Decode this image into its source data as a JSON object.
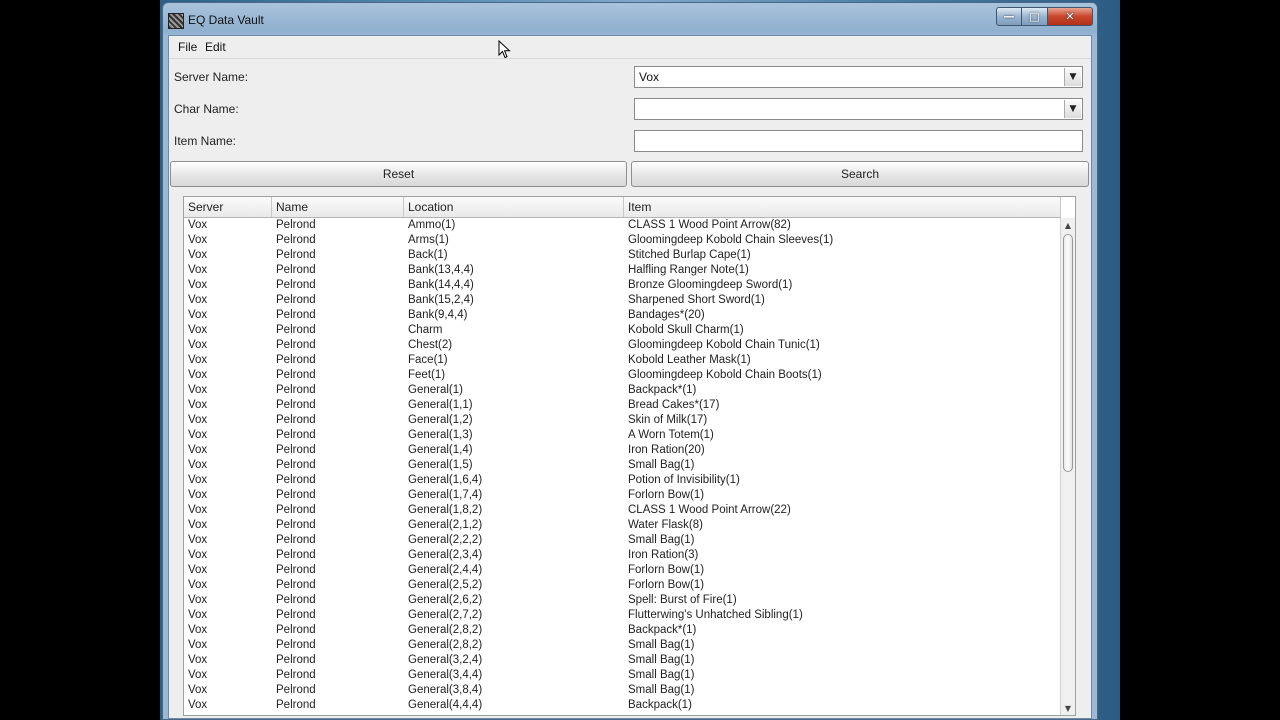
{
  "window": {
    "title": "EQ Data Vault"
  },
  "menu": {
    "file": "File",
    "edit": "Edit"
  },
  "form": {
    "server_label": "Server Name:",
    "server_value": "Vox",
    "char_label": "Char Name:",
    "char_value": "",
    "item_label": "Item Name:",
    "item_value": ""
  },
  "buttons": {
    "reset": "Reset",
    "search": "Search"
  },
  "table": {
    "columns": [
      "Server",
      "Name",
      "Location",
      "Item"
    ],
    "rows": [
      [
        "Vox",
        "Pelrond",
        "Ammo(1)",
        "CLASS 1 Wood Point Arrow(82)"
      ],
      [
        "Vox",
        "Pelrond",
        "Arms(1)",
        "Gloomingdeep Kobold Chain Sleeves(1)"
      ],
      [
        "Vox",
        "Pelrond",
        "Back(1)",
        "Stitched Burlap Cape(1)"
      ],
      [
        "Vox",
        "Pelrond",
        "Bank(13,4,4)",
        "Halfling Ranger Note(1)"
      ],
      [
        "Vox",
        "Pelrond",
        "Bank(14,4,4)",
        "Bronze Gloomingdeep Sword(1)"
      ],
      [
        "Vox",
        "Pelrond",
        "Bank(15,2,4)",
        "Sharpened Short Sword(1)"
      ],
      [
        "Vox",
        "Pelrond",
        "Bank(9,4,4)",
        "Bandages*(20)"
      ],
      [
        "Vox",
        "Pelrond",
        "Charm",
        "Kobold Skull Charm(1)"
      ],
      [
        "Vox",
        "Pelrond",
        "Chest(2)",
        "Gloomingdeep Kobold Chain Tunic(1)"
      ],
      [
        "Vox",
        "Pelrond",
        "Face(1)",
        "Kobold Leather Mask(1)"
      ],
      [
        "Vox",
        "Pelrond",
        "Feet(1)",
        "Gloomingdeep Kobold Chain Boots(1)"
      ],
      [
        "Vox",
        "Pelrond",
        "General(1)",
        "Backpack*(1)"
      ],
      [
        "Vox",
        "Pelrond",
        "General(1,1)",
        "Bread Cakes*(17)"
      ],
      [
        "Vox",
        "Pelrond",
        "General(1,2)",
        "Skin of Milk(17)"
      ],
      [
        "Vox",
        "Pelrond",
        "General(1,3)",
        "A Worn Totem(1)"
      ],
      [
        "Vox",
        "Pelrond",
        "General(1,4)",
        "Iron Ration(20)"
      ],
      [
        "Vox",
        "Pelrond",
        "General(1,5)",
        "Small Bag(1)"
      ],
      [
        "Vox",
        "Pelrond",
        "General(1,6,4)",
        "Potion of Invisibility(1)"
      ],
      [
        "Vox",
        "Pelrond",
        "General(1,7,4)",
        "Forlorn Bow(1)"
      ],
      [
        "Vox",
        "Pelrond",
        "General(1,8,2)",
        "CLASS 1 Wood Point Arrow(22)"
      ],
      [
        "Vox",
        "Pelrond",
        "General(2,1,2)",
        "Water Flask(8)"
      ],
      [
        "Vox",
        "Pelrond",
        "General(2,2,2)",
        "Small Bag(1)"
      ],
      [
        "Vox",
        "Pelrond",
        "General(2,3,4)",
        "Iron Ration(3)"
      ],
      [
        "Vox",
        "Pelrond",
        "General(2,4,4)",
        "Forlorn Bow(1)"
      ],
      [
        "Vox",
        "Pelrond",
        "General(2,5,2)",
        "Forlorn Bow(1)"
      ],
      [
        "Vox",
        "Pelrond",
        "General(2,6,2)",
        "Spell: Burst of Fire(1)"
      ],
      [
        "Vox",
        "Pelrond",
        "General(2,7,2)",
        "Flutterwing's Unhatched Sibling(1)"
      ],
      [
        "Vox",
        "Pelrond",
        "General(2,8,2)",
        "Backpack*(1)"
      ],
      [
        "Vox",
        "Pelrond",
        "General(2,8,2)",
        "Small Bag(1)"
      ],
      [
        "Vox",
        "Pelrond",
        "General(3,2,4)",
        "Small Bag(1)"
      ],
      [
        "Vox",
        "Pelrond",
        "General(3,4,4)",
        "Small Bag(1)"
      ],
      [
        "Vox",
        "Pelrond",
        "General(3,8,4)",
        "Small Bag(1)"
      ],
      [
        "Vox",
        "Pelrond",
        "General(4,4,4)",
        "Backpack(1)"
      ]
    ]
  },
  "icons": {
    "app": "app-icon",
    "minimize": "minimize-icon",
    "maximize": "maximize-icon",
    "close": "close-icon",
    "dropdown": "chevron-down-icon",
    "cursor": "mouse-pointer-icon"
  },
  "colors": {
    "close_button": "#c8462a",
    "window_frame": "#9bb9d6",
    "client_bg": "#eeeeee"
  }
}
